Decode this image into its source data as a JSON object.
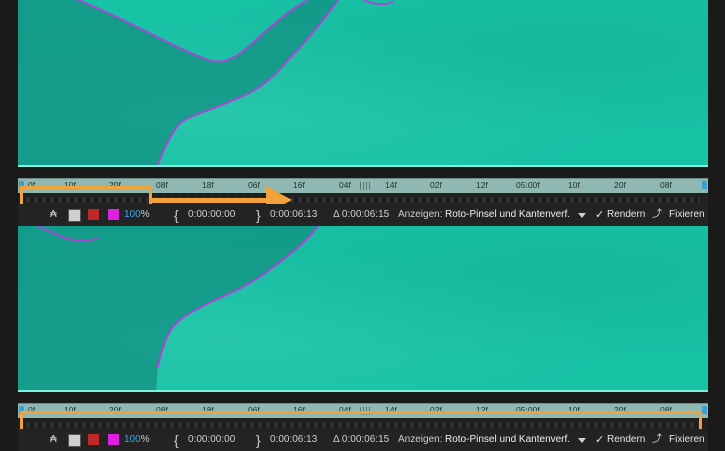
{
  "colors": {
    "footage": "#17c2a5",
    "roto_outline": "#a24ad6",
    "highlight": "#f2a23a",
    "ruler": "#8fb8b2",
    "accent_blue": "#3aa8e8"
  },
  "ruler": {
    "ticks": [
      "0f",
      "10f",
      "20f",
      "08f",
      "18f",
      "06f",
      "16f",
      "04f",
      "14f",
      "02f",
      "12f",
      "05:00f",
      "10f",
      "20f",
      "08f"
    ]
  },
  "controls": {
    "zoom_value": "100",
    "zoom_unit": "%",
    "in_time": "0:00:00:00",
    "out_time": "0:00:06:13",
    "duration_prefix": "Δ",
    "duration": "0:00:06:15",
    "view_label": "Anzeigen:",
    "view_value": "Roto-Pinsel und Kantenverf.",
    "render_label": "Rendern",
    "freeze_label": "Fixieren"
  },
  "icons": {
    "brace_in": "{",
    "brace_out": "}",
    "check": "✓"
  }
}
